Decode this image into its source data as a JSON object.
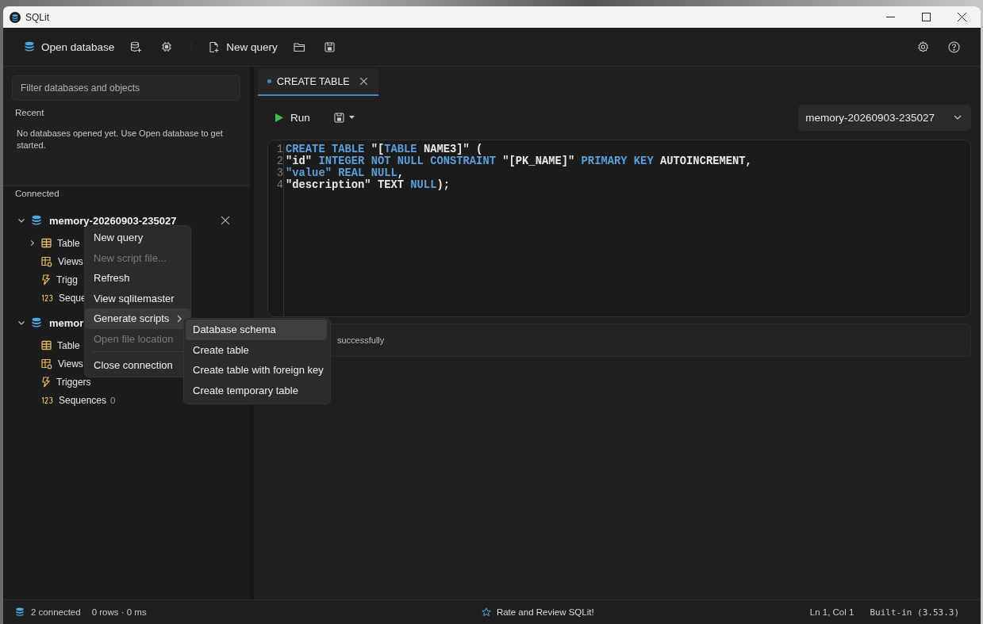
{
  "window": {
    "title": "SQLit"
  },
  "toolbar": {
    "left": [
      {
        "kind": "open",
        "label": "Open database"
      },
      {
        "kind": "add-db"
      },
      {
        "kind": "chip"
      },
      {
        "kind": "sep"
      },
      {
        "kind": "new-query",
        "label": "New query"
      },
      {
        "kind": "folder"
      },
      {
        "kind": "save"
      }
    ],
    "right": [
      {
        "kind": "settings"
      },
      {
        "kind": "help"
      }
    ]
  },
  "sidebar": {
    "filter": {
      "placeholder": "Filter databases and objects"
    },
    "recent_title": "Recent",
    "recent_message": "No databases opened yet. Use Open database to get started.",
    "connected_title": "Connected",
    "databases": [
      {
        "name": "memory-20260903-235027",
        "expanded": true,
        "closable": true,
        "children": [
          {
            "kind": "table",
            "label": "Table",
            "expanded": false
          },
          {
            "kind": "view",
            "label": "Views"
          },
          {
            "kind": "trigger",
            "label": "Trigg"
          },
          {
            "kind": "sequence",
            "label": "Seque"
          }
        ]
      },
      {
        "name": "memor",
        "expanded": true,
        "closable": false,
        "children": [
          {
            "kind": "table",
            "label": "Table"
          },
          {
            "kind": "view",
            "label": "Views"
          },
          {
            "kind": "trigger",
            "label": "Triggers"
          },
          {
            "kind": "sequence",
            "label": "Sequences",
            "count": "0"
          }
        ]
      }
    ]
  },
  "tabs": [
    {
      "label": "CREATE TABLE",
      "modified": true,
      "selected": true
    }
  ],
  "query_toolbar": {
    "run": "Run",
    "database": "memory-20260903-235027"
  },
  "editor": {
    "lines": [
      {
        "number": "1",
        "tokens": [
          {
            "text": "CREATE TABLE",
            "kind": "keyword"
          },
          {
            "text": " \"[",
            "kind": "plain"
          },
          {
            "text": "TABLE",
            "kind": "keyword"
          },
          {
            "text": " NAME3]\" (",
            "kind": "plain"
          }
        ]
      },
      {
        "number": "2",
        "tokens": [
          {
            "text": "\"id\" ",
            "kind": "plain"
          },
          {
            "text": "INTEGER NOT NULL CONSTRAINT",
            "kind": "keyword"
          },
          {
            "text": " \"[PK_NAME]\" ",
            "kind": "plain"
          },
          {
            "text": "PRIMARY KEY",
            "kind": "keyword"
          },
          {
            "text": " AUTOINCREMENT,",
            "kind": "plain"
          }
        ]
      },
      {
        "number": "3",
        "tokens": [
          {
            "text": "\"value\" REAL NULL",
            "kind": "keyword"
          },
          {
            "text": ",",
            "kind": "plain"
          }
        ]
      },
      {
        "number": "4",
        "tokens": [
          {
            "text": "\"description\" TEXT ",
            "kind": "plain"
          },
          {
            "text": "NULL",
            "kind": "keyword"
          },
          {
            "text": ");",
            "kind": "plain"
          }
        ]
      }
    ]
  },
  "message": "successfully",
  "context_menu": {
    "items": [
      {
        "label": "New query",
        "disabled": false,
        "highlighted": false
      },
      {
        "label": "New script file...",
        "disabled": true,
        "highlighted": false
      },
      {
        "label": "Refresh",
        "disabled": false,
        "highlighted": false
      },
      {
        "label": "View sqlitemaster",
        "disabled": false,
        "highlighted": false
      },
      {
        "label": "Generate scripts",
        "disabled": false,
        "highlighted": true,
        "submenu": true
      },
      {
        "label": "Open file location",
        "disabled": true,
        "highlighted": false
      },
      {
        "label": "Close connection",
        "disabled": false,
        "highlighted": false,
        "separator_before": true
      }
    ],
    "submenu": [
      {
        "label": "Database schema",
        "highlighted": true
      },
      {
        "label": "Create table",
        "highlighted": false
      },
      {
        "label": "Create table with foreign key",
        "highlighted": false
      },
      {
        "label": "Create temporary table",
        "highlighted": false
      }
    ]
  },
  "status_bar": {
    "connections": "2 connected",
    "rows": "0 rows · 0 ms",
    "rate": "Rate and Review SQLit!",
    "position": "Ln 1, Col 1",
    "engine": "Built-in (3.53.3)"
  }
}
